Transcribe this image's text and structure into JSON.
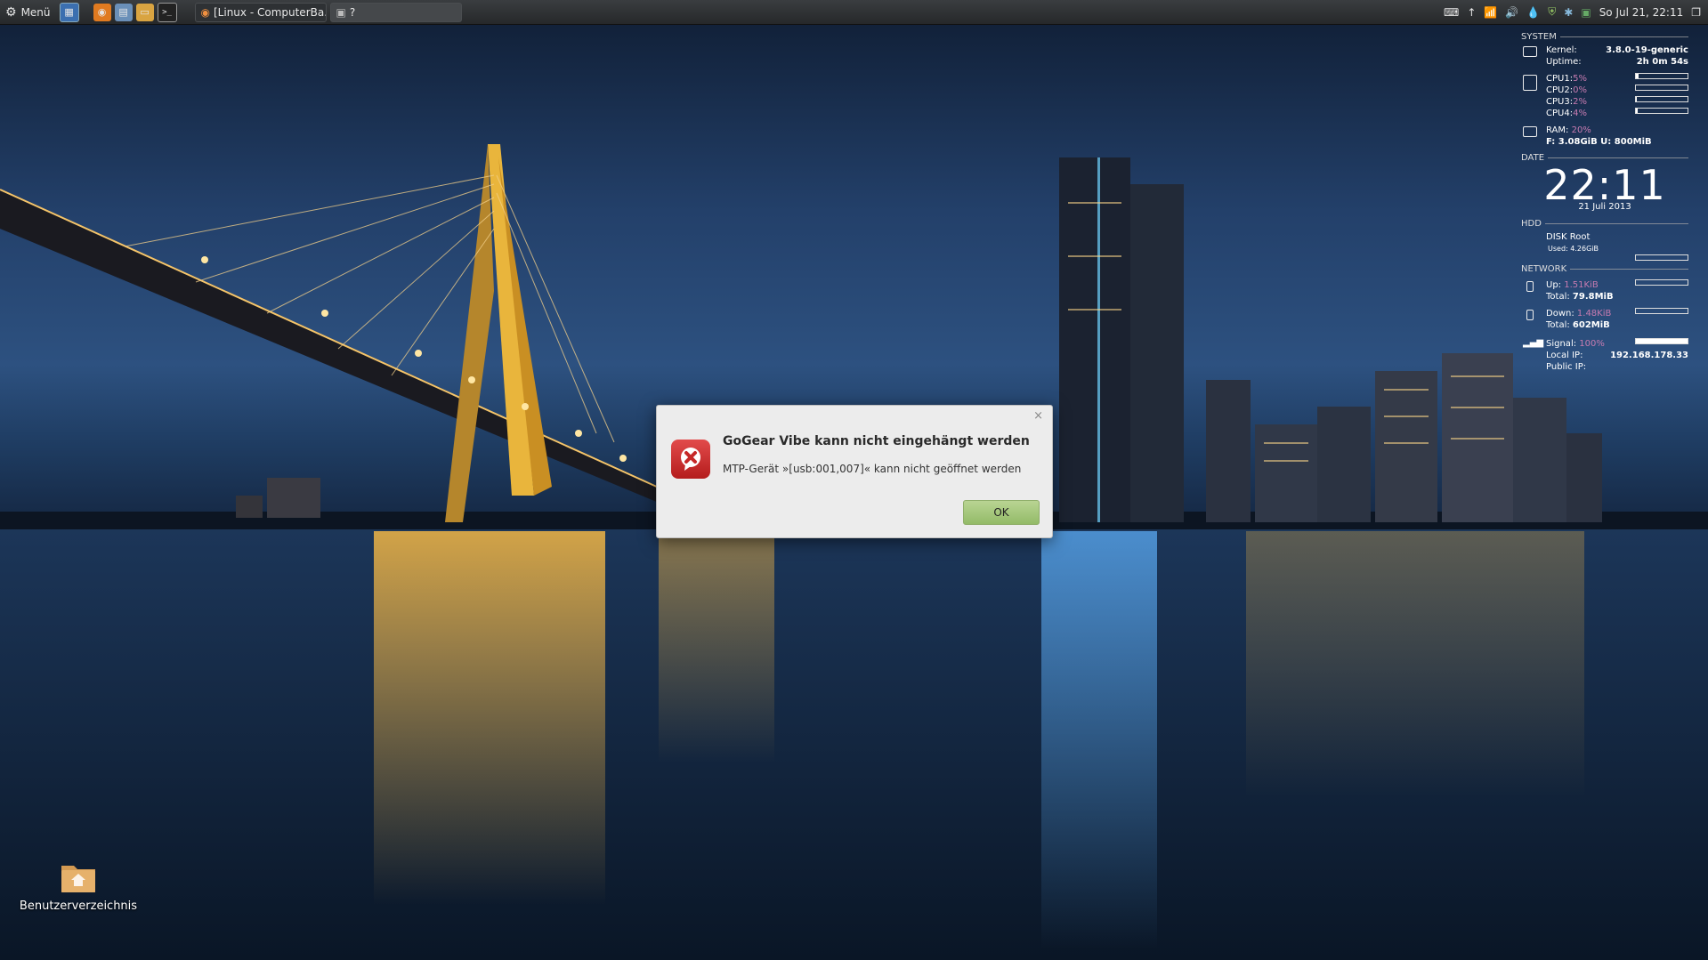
{
  "panel": {
    "menu_label": "Menü",
    "tasks": [
      {
        "label": "[Linux - ComputerBa..."
      },
      {
        "label": "?"
      }
    ],
    "clock": "So Jul 21, 22:11"
  },
  "conky": {
    "system": {
      "heading": "SYSTEM",
      "kernel_label": "Kernel:",
      "kernel_value": "3.8.0-19-generic",
      "uptime_label": "Uptime:",
      "uptime_value": "2h 0m 54s",
      "cpus": [
        {
          "label": "CPU1:",
          "value": "5%",
          "level": 0.05
        },
        {
          "label": "CPU2:",
          "value": "0%",
          "level": 0.0
        },
        {
          "label": "CPU3:",
          "value": "2%",
          "level": 0.02
        },
        {
          "label": "CPU4:",
          "value": "4%",
          "level": 0.04
        }
      ],
      "ram_label": "RAM:",
      "ram_value": "20%",
      "ram_detail": "F: 3.08GiB U: 800MiB"
    },
    "date": {
      "heading": "DATE",
      "time": "22:11",
      "date": "21 Juli 2013"
    },
    "hdd": {
      "heading": "HDD",
      "disk_label": "DISK Root",
      "used_label": "Used: 4.26GiB"
    },
    "network": {
      "heading": "NETWORK",
      "up_label": "Up:",
      "up_value": "1.51KiB",
      "up_total_label": "Total:",
      "up_total": "79.8MiB",
      "down_label": "Down:",
      "down_value": "1.48KiB",
      "down_total_label": "Total:",
      "down_total": "602MiB",
      "signal_label": "Signal:",
      "signal_value": "100%",
      "signal_level": 1.0,
      "local_ip_label": "Local IP:",
      "local_ip": "192.168.178.33",
      "public_ip_label": "Public IP:"
    }
  },
  "dialog": {
    "title": "GoGear Vibe kann nicht eingehängt werden",
    "message": "MTP-Gerät »[usb:001,007]« kann nicht geöffnet werden",
    "ok_label": "OK",
    "close_glyph": "×"
  },
  "desktop": {
    "home_label": "Benutzerverzeichnis"
  },
  "colors": {
    "error_red": "#c62828",
    "ok_green": "#a5c77f",
    "accent_pink": "#c77bb0"
  }
}
